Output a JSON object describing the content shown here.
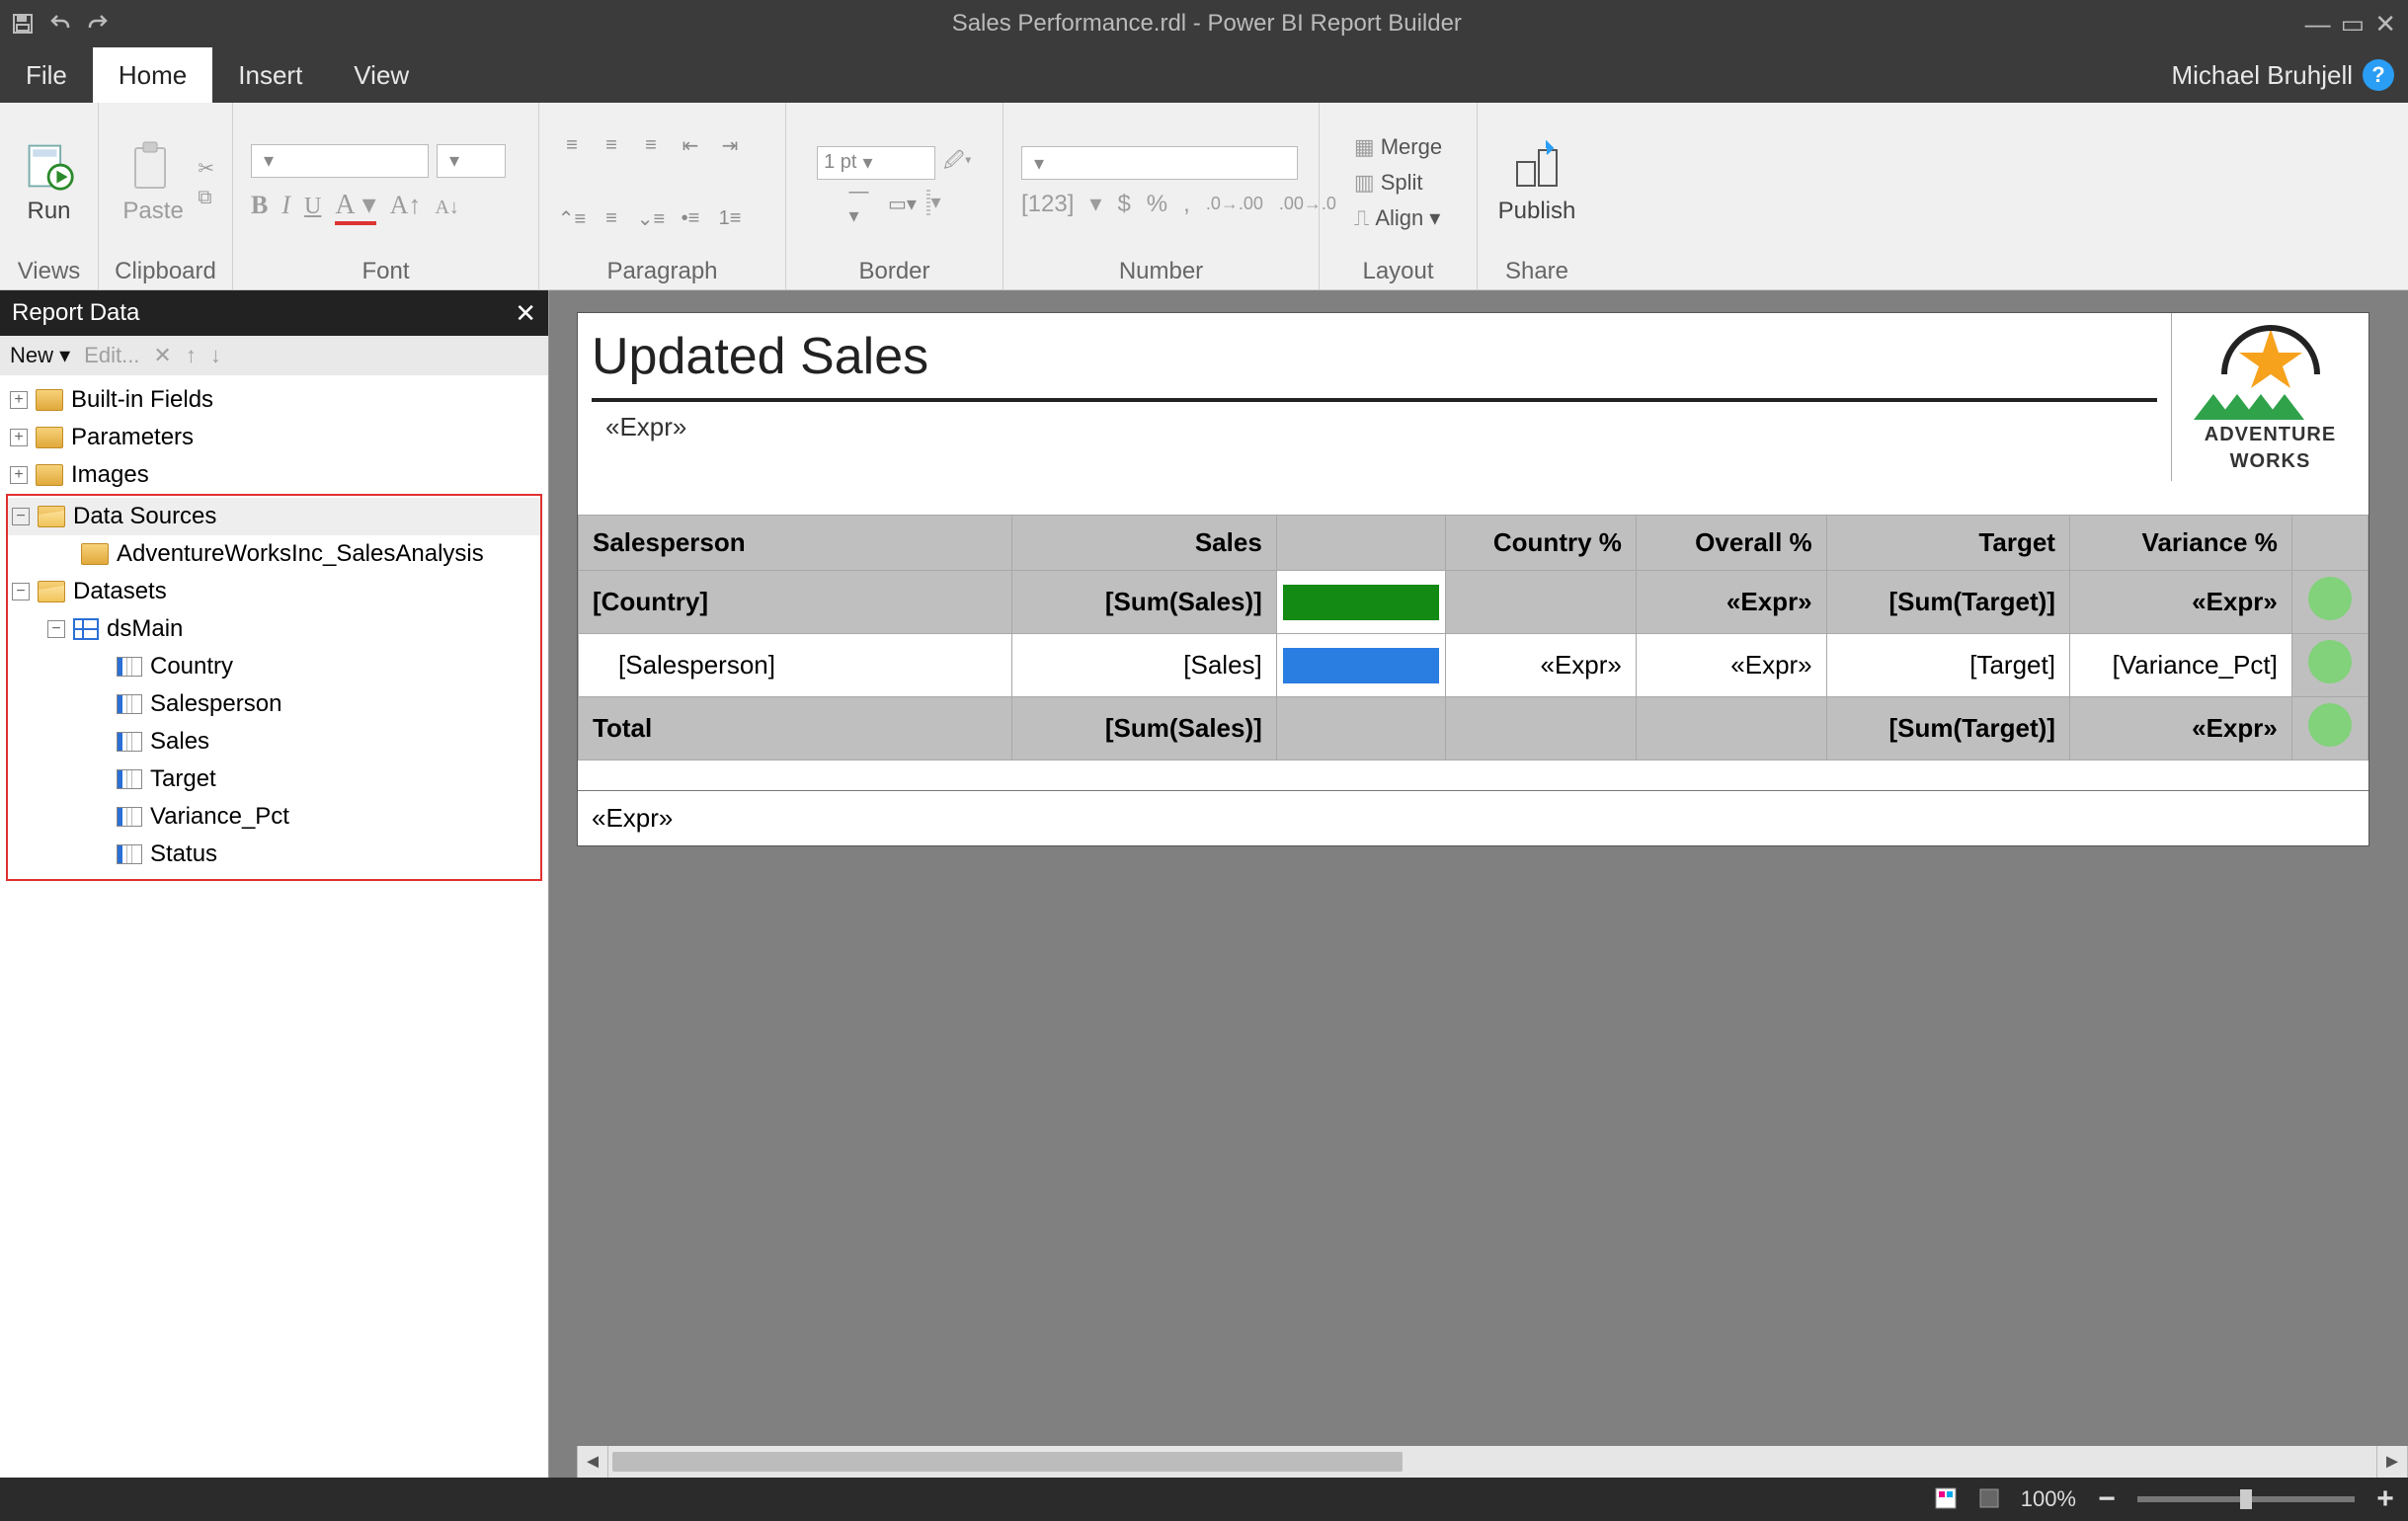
{
  "window": {
    "title": "Sales Performance.rdl - Power BI Report Builder"
  },
  "menu": {
    "file": "File",
    "home": "Home",
    "insert": "Insert",
    "view": "View",
    "user": "Michael Bruhjell"
  },
  "ribbon": {
    "run": "Run",
    "paste": "Paste",
    "views": "Views",
    "clipboard": "Clipboard",
    "font": "Font",
    "paragraph": "Paragraph",
    "border": "Border",
    "border_width": "1 pt",
    "number": "Number",
    "layout": "Layout",
    "share": "Share",
    "merge": "Merge",
    "split": "Split",
    "align": "Align",
    "publish": "Publish",
    "num_placeholder": "[123]",
    "currency": "$",
    "percent": "%",
    "comma": ","
  },
  "panel": {
    "title": "Report Data",
    "new": "New",
    "edit": "Edit...",
    "tree": {
      "builtin": "Built-in Fields",
      "parameters": "Parameters",
      "images": "Images",
      "datasources": "Data Sources",
      "datasource1": "AdventureWorksInc_SalesAnalysis",
      "datasets": "Datasets",
      "dsMain": "dsMain",
      "fields": [
        "Country",
        "Salesperson",
        "Sales",
        "Target",
        "Variance_Pct",
        "Status"
      ]
    }
  },
  "report": {
    "title": "Updated Sales",
    "expr": "«Expr»",
    "logo_line1": "ADVENTURE",
    "logo_line2": "WORKS",
    "headers": {
      "salesperson": "Salesperson",
      "sales": "Sales",
      "country_pct": "Country %",
      "overall_pct": "Overall %",
      "target": "Target",
      "variance_pct": "Variance %"
    },
    "row_country": {
      "c0": "[Country]",
      "c1": "[Sum(Sales)]",
      "c4": "«Expr»",
      "c5": "[Sum(Target)]",
      "c6": "«Expr»"
    },
    "row_sp": {
      "c0": "[Salesperson]",
      "c1": "[Sales]",
      "c3": "«Expr»",
      "c4": "«Expr»",
      "c5": "[Target]",
      "c6": "[Variance_Pct]"
    },
    "row_total": {
      "c0": "Total",
      "c1": "[Sum(Sales)]",
      "c5": "[Sum(Target)]",
      "c6": "«Expr»"
    },
    "footer_expr": "«Expr»"
  },
  "status": {
    "zoom": "100%"
  }
}
